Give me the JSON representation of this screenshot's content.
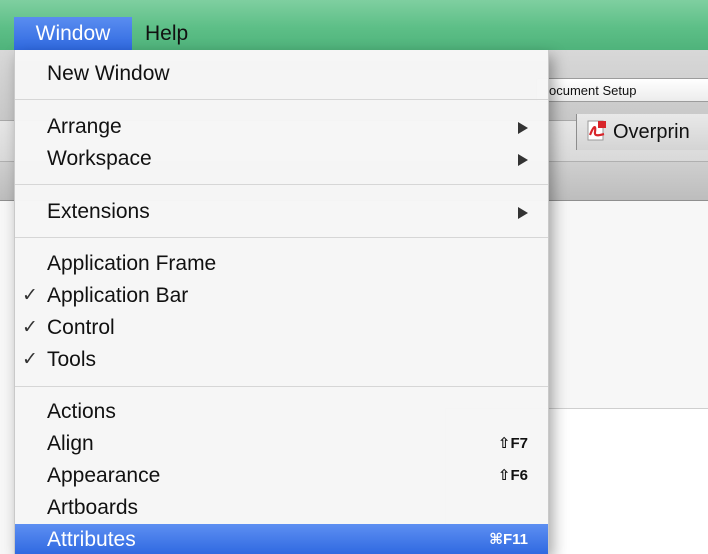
{
  "menubar": {
    "window_label": "Window",
    "help_label": "Help"
  },
  "background": {
    "document_setup_label": "ocument Setup",
    "overprint_tab_label": "Overprin"
  },
  "window_menu": {
    "items": [
      {
        "label": "New Window"
      },
      {
        "label": "Arrange",
        "submenu": true
      },
      {
        "label": "Workspace",
        "submenu": true
      },
      {
        "label": "Extensions",
        "submenu": true
      },
      {
        "label": "Application Frame",
        "checked": false
      },
      {
        "label": "Application Bar",
        "checked": true,
        "check_mark": "✓"
      },
      {
        "label": "Control",
        "checked": true,
        "check_mark": "✓"
      },
      {
        "label": "Tools",
        "checked": true,
        "check_mark": "✓"
      },
      {
        "label": "Actions"
      },
      {
        "label": "Align",
        "shortcut": "⇧F7"
      },
      {
        "label": "Appearance",
        "shortcut": "⇧F6"
      },
      {
        "label": "Artboards"
      },
      {
        "label": "Attributes",
        "shortcut": "⌘F11",
        "highlighted": true
      }
    ]
  },
  "colors": {
    "menubar_green": "#5dbf87",
    "selection_blue": "#2f69e0"
  },
  "icons": {
    "submenu": "submenu-arrow-icon",
    "check": "checkmark-icon",
    "pdf": "pdf-icon"
  }
}
